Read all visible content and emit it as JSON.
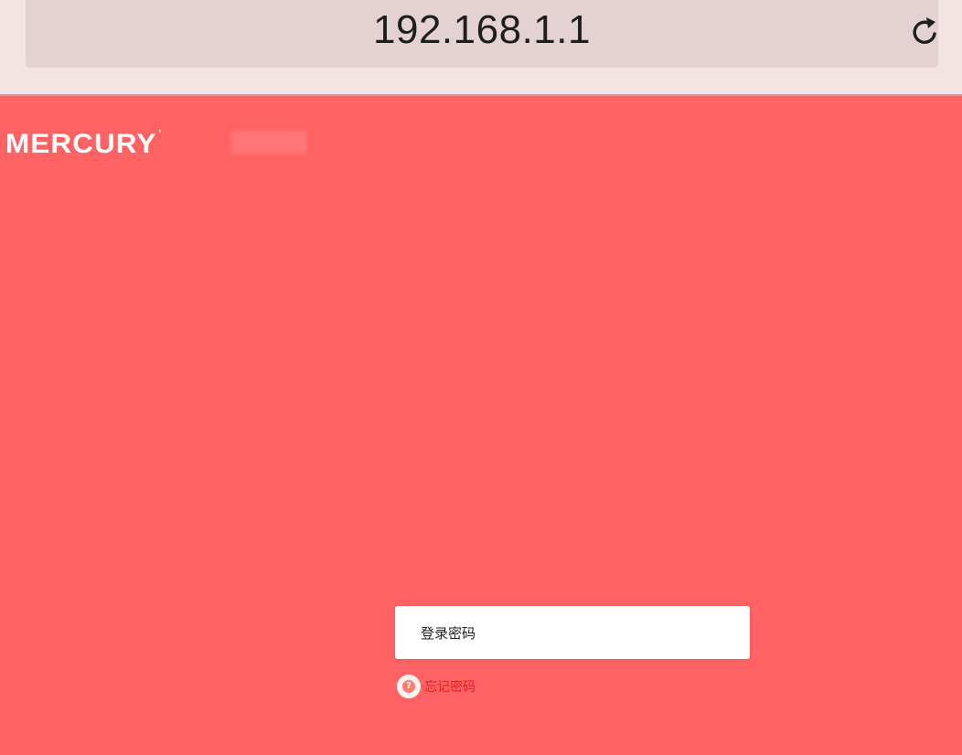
{
  "browser": {
    "url": "192.168.1.1",
    "reload_icon": "reload-icon"
  },
  "page": {
    "logo_text": "MERCURY",
    "logo_trademark": "'",
    "password_placeholder": "登录密码",
    "forgot_password_label": "忘记密码",
    "help_icon": "question-icon",
    "background_color": "#fe6262"
  }
}
